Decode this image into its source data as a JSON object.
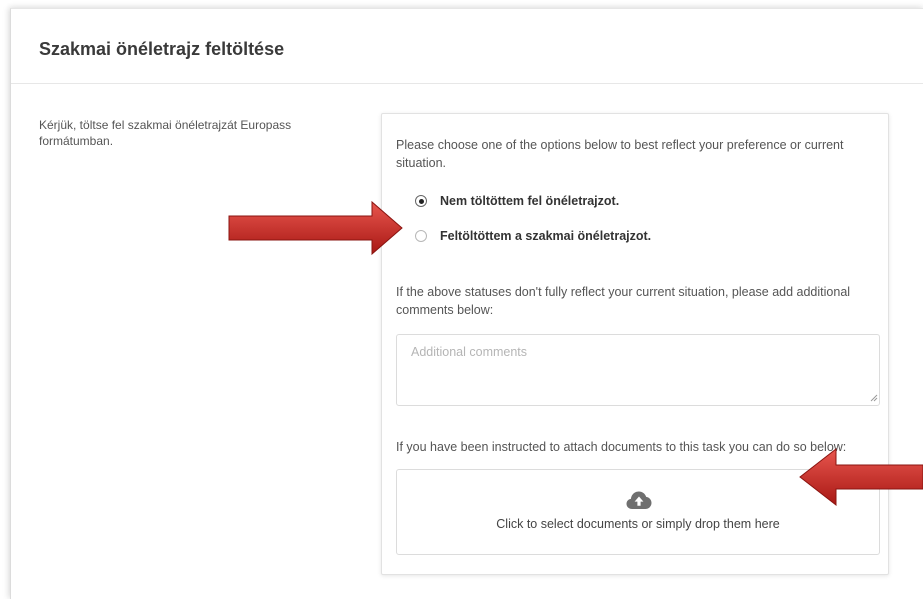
{
  "page": {
    "title": "Szakmai önéletrajz feltöltése",
    "intro": "Kérjük, töltse fel szakmai önéletrajzát Europass formátumban."
  },
  "task": {
    "prompt": "Please choose one of the options below to best reflect your preference or current situation.",
    "options": [
      {
        "label": "Nem töltöttem fel önéletrajzot.",
        "checked": true
      },
      {
        "label": "Feltöltöttem a szakmai önéletrajzot.",
        "checked": false
      }
    ],
    "comments_prompt": "If the above statuses don't fully reflect your current situation, please add additional comments below:",
    "comments_placeholder": "Additional comments",
    "attach_prompt": "If you have been instructed to attach documents to this task you can do so below:",
    "drop_label": "Click to select documents or simply drop them here"
  },
  "icons": {
    "upload": "cloud-upload-icon",
    "annotation": "red-arrow-icon"
  },
  "colors": {
    "arrow": "#c0201b",
    "arrow_highlight": "#e8564e"
  }
}
